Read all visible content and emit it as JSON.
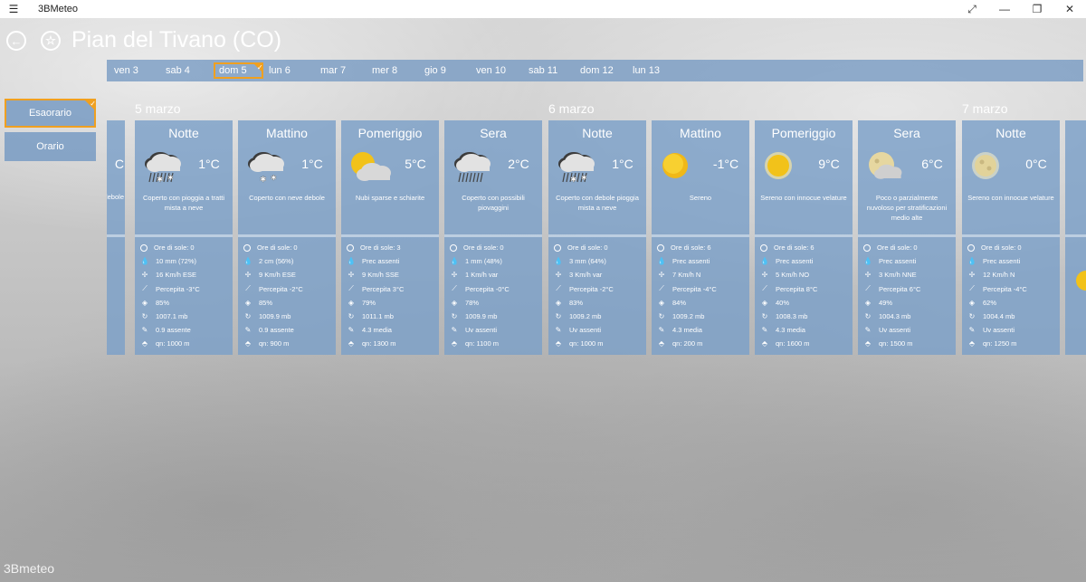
{
  "titlebar": {
    "menu_icon": "☰",
    "app_title": "3BMeteo",
    "expand_icon": "⤢",
    "minimize_icon": "—",
    "restore_icon": "❐",
    "close_icon": "✕"
  },
  "header": {
    "back_icon": "←",
    "favorite_icon": "☆",
    "city": "Pian del Tivano (CO)"
  },
  "days": [
    "ven 3",
    "sab 4",
    "dom 5",
    "lun 6",
    "mar 7",
    "mer 8",
    "gio 9",
    "ven 10",
    "sab 11",
    "dom 12",
    "lun 13"
  ],
  "selected_day": "dom 5",
  "side_nav": {
    "esaorario": "Esaorario",
    "orario": "Orario"
  },
  "date_labels": [
    "5 marzo",
    "6 marzo",
    "7 marzo"
  ],
  "row_labels": {
    "sun_prefix": "Ore di sole:"
  },
  "partial_left": {
    "temp": "C",
    "desc": "debole"
  },
  "cards": [
    {
      "period": "Notte",
      "icon": "rain-snow-icon",
      "temp": "1°C",
      "desc": "Coperto con pioggia a tratti mista a neve",
      "sun": "Ore di sole: 0",
      "prec": "10 mm (72%)",
      "wind": "16 Km/h ESE",
      "feel": "Percepita -3°C",
      "hum": "85%",
      "press": "1007.1 mb",
      "uv": "0.9 assente",
      "qn": "qn: 1000 m"
    },
    {
      "period": "Mattino",
      "icon": "snow-icon",
      "temp": "1°C",
      "desc": "Coperto con neve debole",
      "sun": "Ore di sole: 0",
      "prec": "2 cm (56%)",
      "wind": "9 Km/h ESE",
      "feel": "Percepita -2°C",
      "hum": "85%",
      "press": "1009.9 mb",
      "uv": "0.9 assente",
      "qn": "qn: 900 m"
    },
    {
      "period": "Pomeriggio",
      "icon": "partly-cloudy-icon",
      "temp": "5°C",
      "desc": "Nubi sparse e schiarite",
      "sun": "Ore di sole: 3",
      "prec": "Prec assenti",
      "wind": "9 Km/h SSE",
      "feel": "Percepita 3°C",
      "hum": "79%",
      "press": "1011.1 mb",
      "uv": "4.3 media",
      "qn": "qn: 1300 m"
    },
    {
      "period": "Sera",
      "icon": "rain-icon",
      "temp": "2°C",
      "desc": "Coperto con possibili piovaggini",
      "sun": "Ore di sole: 0",
      "prec": "1 mm (48%)",
      "wind": "1 Km/h var",
      "feel": "Percepita -0°C",
      "hum": "78%",
      "press": "1009.9 mb",
      "uv": "Uv assenti",
      "qn": "qn: 1100 m"
    },
    {
      "period": "Notte",
      "icon": "rain-snow-icon",
      "temp": "1°C",
      "desc": "Coperto con debole pioggia mista a neve",
      "sun": "Ore di sole: 0",
      "prec": "3 mm (64%)",
      "wind": "3 Km/h var",
      "feel": "Percepita -2°C",
      "hum": "83%",
      "press": "1009.2 mb",
      "uv": "Uv assenti",
      "qn": "qn: 1000 m"
    },
    {
      "period": "Mattino",
      "icon": "sun-icon",
      "temp": "-1°C",
      "desc": "Sereno",
      "sun": "Ore di sole: 6",
      "prec": "Prec assenti",
      "wind": "7 Km/h N",
      "feel": "Percepita -4°C",
      "hum": "84%",
      "press": "1009.2 mb",
      "uv": "4.3 media",
      "qn": "qn: 200 m"
    },
    {
      "period": "Pomeriggio",
      "icon": "sun-haze-icon",
      "temp": "9°C",
      "desc": "Sereno con innocue velature",
      "sun": "Ore di sole: 6",
      "prec": "Prec assenti",
      "wind": "5 Km/h NO",
      "feel": "Percepita 8°C",
      "hum": "40%",
      "press": "1008.3 mb",
      "uv": "4.3 media",
      "qn": "qn: 1600 m"
    },
    {
      "period": "Sera",
      "icon": "moon-cloud-icon",
      "temp": "6°C",
      "desc": "Poco o parzialmente nuvoloso per stratificazioni medio alte",
      "sun": "Ore di sole: 0",
      "prec": "Prec assenti",
      "wind": "3 Km/h NNE",
      "feel": "Percepita 6°C",
      "hum": "49%",
      "press": "1004.3 mb",
      "uv": "Uv assenti",
      "qn": "qn: 1500 m"
    },
    {
      "period": "Notte",
      "icon": "moon-haze-icon",
      "temp": "0°C",
      "desc": "Sereno con innocue velature",
      "sun": "Ore di sole: 0",
      "prec": "Prec assenti",
      "wind": "12 Km/h N",
      "feel": "Percepita -4°C",
      "hum": "62%",
      "press": "1004.4 mb",
      "uv": "Uv assenti",
      "qn": "qn: 1250 m"
    }
  ],
  "logo": "3Bmeteo"
}
